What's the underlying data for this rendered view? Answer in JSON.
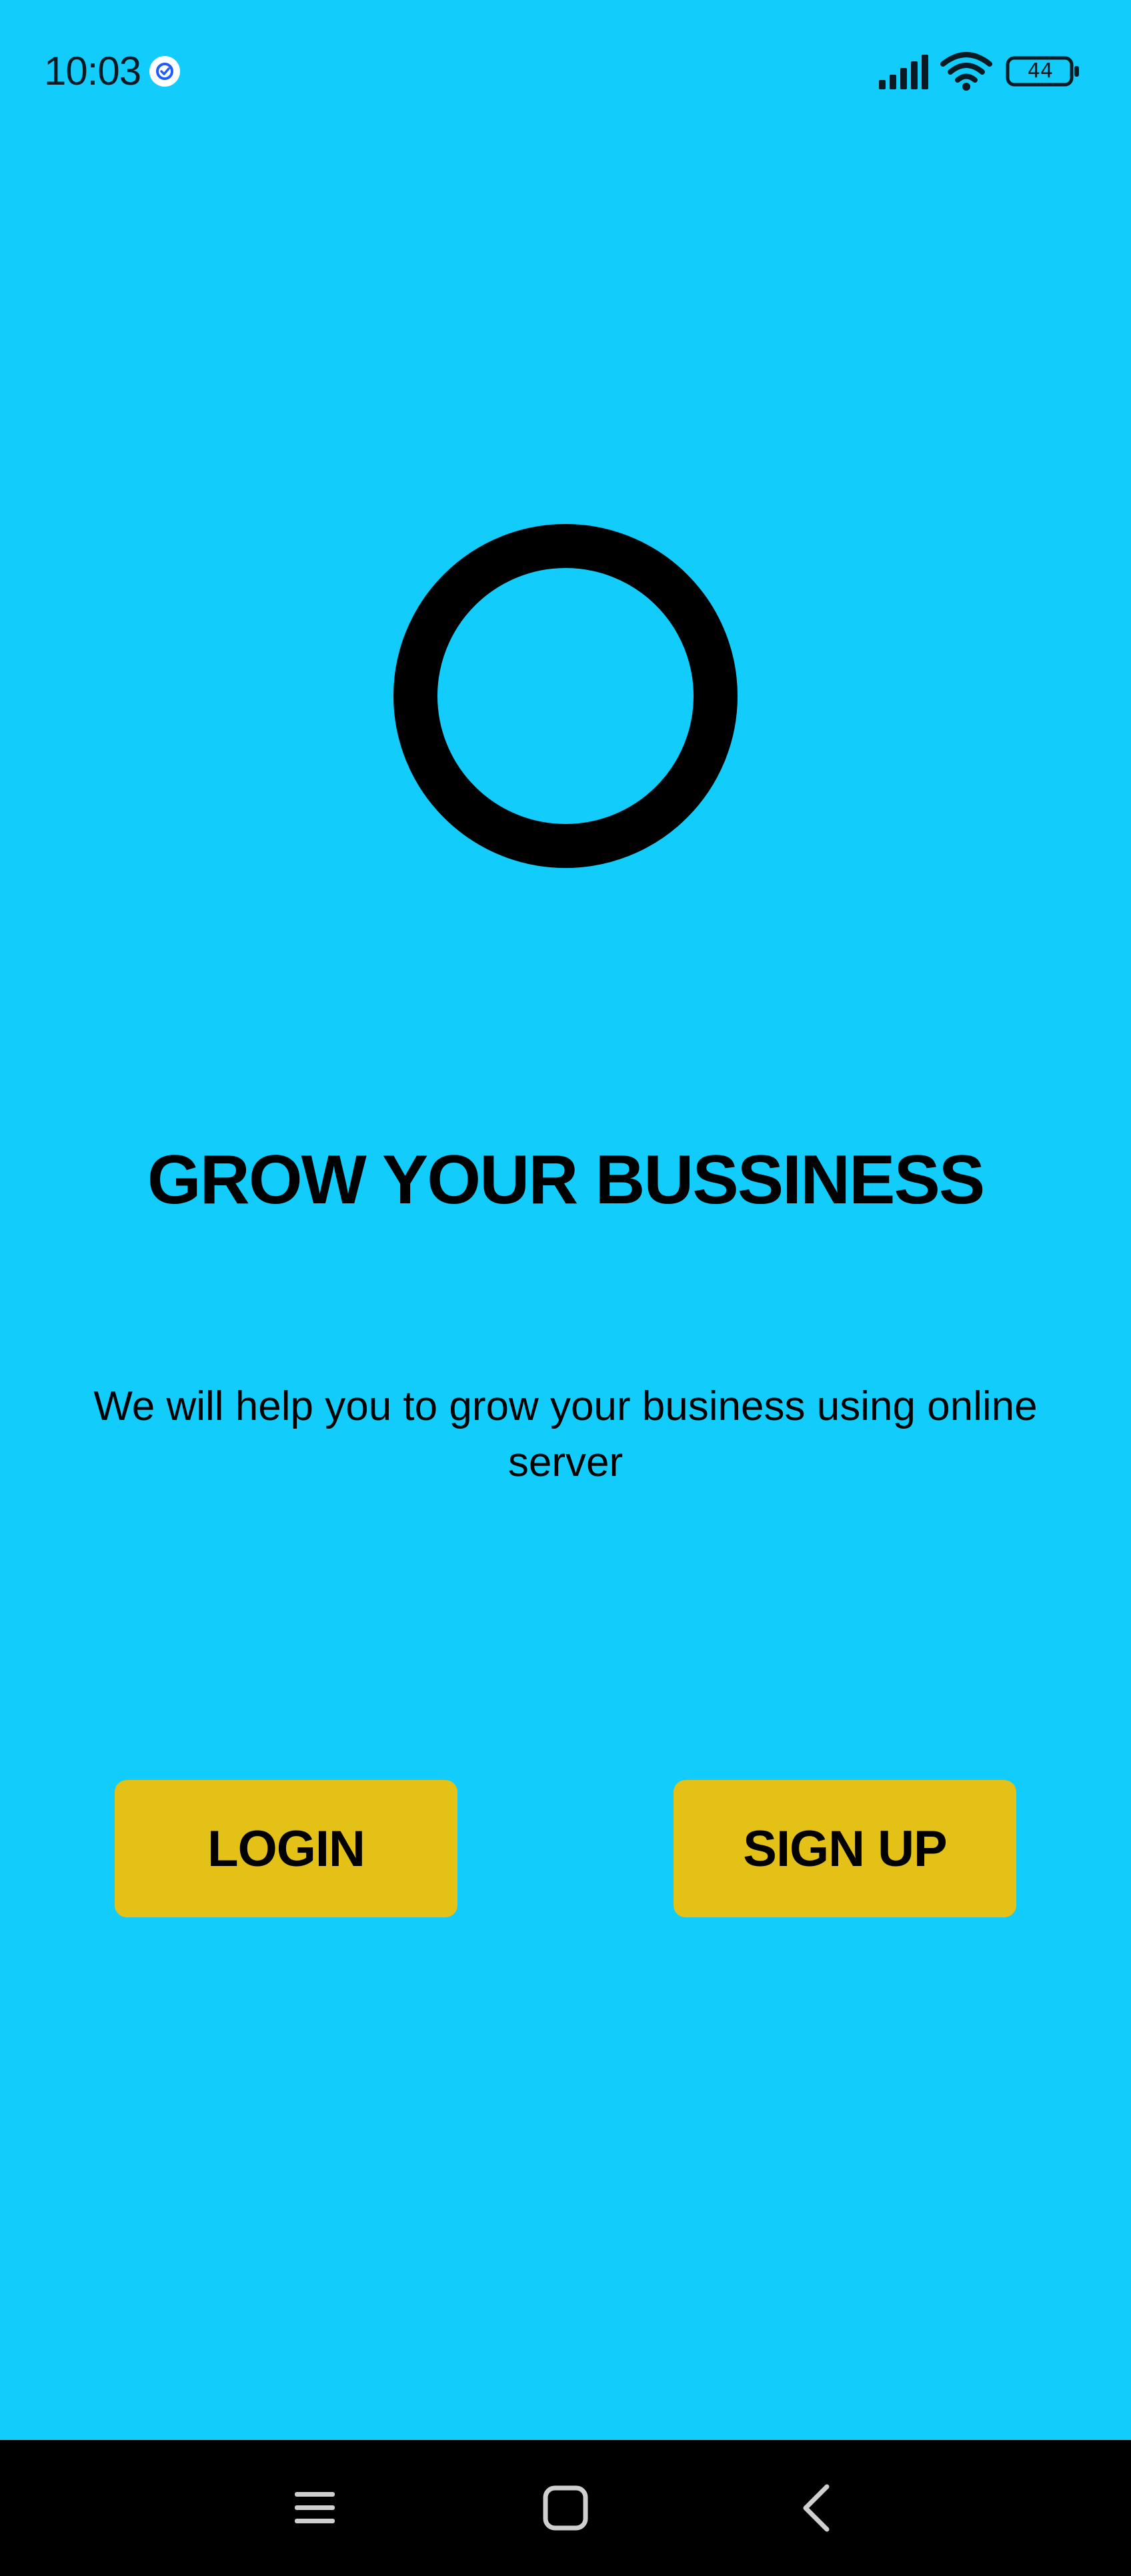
{
  "status_bar": {
    "time": "10:03",
    "battery_level": "44",
    "icons": [
      "app-notification-icon",
      "signal-icon",
      "wifi-icon",
      "battery-icon"
    ]
  },
  "logo": {
    "icon": "ring-logo-icon"
  },
  "main": {
    "headline": "GROW YOUR BUSSINESS",
    "subtitle": "We will help you to grow your business using online server"
  },
  "buttons": {
    "login_label": "LOGIN",
    "signup_label": "SIGN UP"
  },
  "nav_bar": {
    "icons": [
      "menu-icon",
      "home-icon",
      "back-icon"
    ]
  },
  "colors": {
    "background": "#12CCFB",
    "button": "#E3C117",
    "text": "#000000",
    "nav_bar": "#000000"
  }
}
